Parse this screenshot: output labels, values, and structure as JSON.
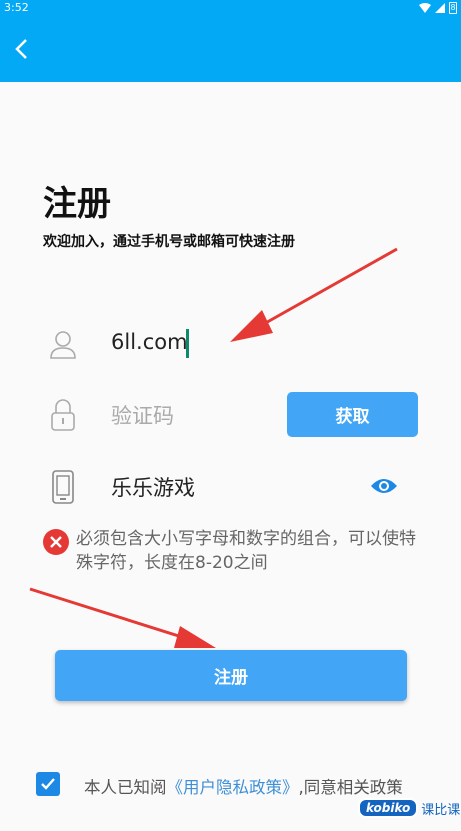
{
  "status_bar": {
    "time": "3:52",
    "battery_label": "8"
  },
  "header": {
    "back_icon": "chevron-left-icon"
  },
  "page": {
    "title": "注册",
    "subtitle": "欢迎加入，通过手机号或邮箱可快速注册"
  },
  "form": {
    "account": {
      "icon": "user-icon",
      "value": "6ll.com"
    },
    "code": {
      "icon": "lock-icon",
      "placeholder": "验证码",
      "button_label": "获取"
    },
    "password": {
      "icon": "phone-icon",
      "value": "乐乐游戏",
      "toggle_icon": "eye-icon"
    },
    "error": {
      "icon": "close-circle-icon",
      "message": "必须包含大小写字母和数字的组合，可以使特殊字符，长度在8-20之间"
    }
  },
  "actions": {
    "register_label": "注册"
  },
  "agreement": {
    "checked": true,
    "prefix": "本人已知阅",
    "link": "《用户隐私政策》",
    "suffix": ",同意相关政策"
  },
  "watermark": {
    "logo": "kobiko",
    "text": "课比课"
  },
  "colors": {
    "primary": "#03a9f4",
    "button": "#42a5f5",
    "error": "#e53935",
    "annotation_arrow": "#e53935"
  }
}
